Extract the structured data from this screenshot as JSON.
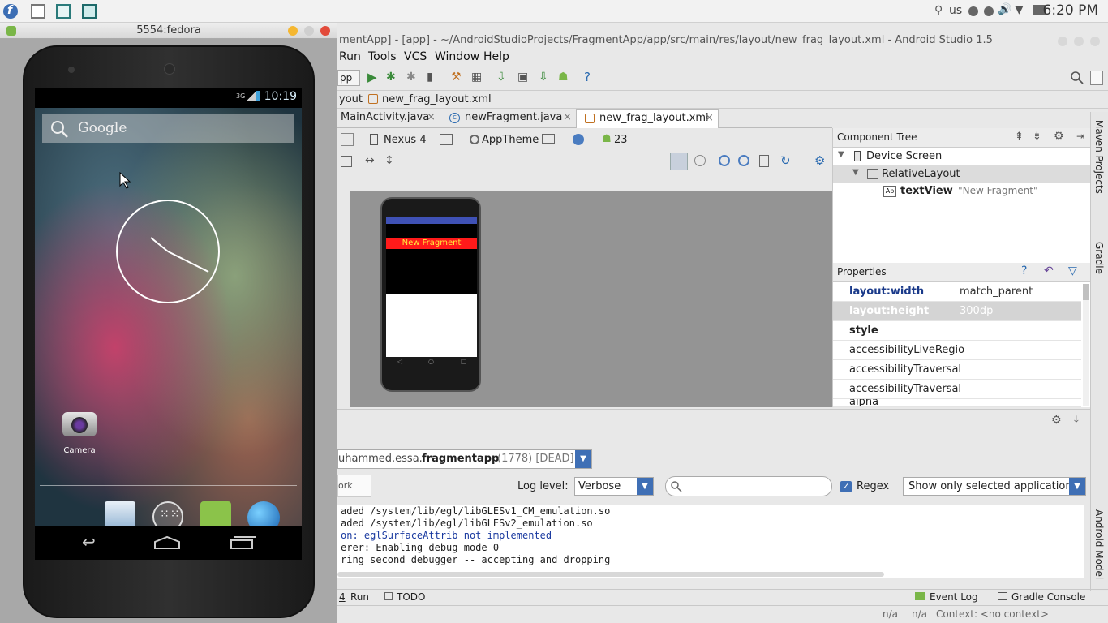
{
  "top_panel": {
    "keyboard": "us",
    "clock": "6:20 PM"
  },
  "emulator": {
    "window_title": "5554:fedora",
    "status_time": "10:19",
    "status_network": "3G",
    "search_label": "Google",
    "camera_label": "Camera"
  },
  "studio": {
    "window_title": "mentApp] - [app] - ~/AndroidStudioProjects/FragmentApp/app/src/main/res/layout/new_frag_layout.xml - Android Studio 1.5",
    "menu": [
      "Run",
      "Tools",
      "VCS",
      "Window",
      "Help"
    ],
    "toolbar_dropdown": "pp",
    "breadcrumb": [
      "yout",
      "new_frag_layout.xml"
    ],
    "tabs": [
      {
        "label": "MainActivity.java"
      },
      {
        "label": "newFragment.java"
      },
      {
        "label": "new_frag_layout.xml"
      }
    ],
    "designer": {
      "device": "Nexus 4",
      "theme": "AppTheme",
      "api": "23",
      "preview_text": "New Fragment"
    },
    "component_tree": {
      "title": "Component Tree",
      "nodes": [
        {
          "label": "Device Screen"
        },
        {
          "label": "RelativeLayout"
        },
        {
          "label": "textView",
          "detail": "- \"New Fragment\""
        }
      ]
    },
    "properties": {
      "title": "Properties",
      "rows": [
        {
          "name": "layout:width",
          "value": "match_parent"
        },
        {
          "name": "layout:height",
          "value": "300dp"
        },
        {
          "name": "style",
          "value": ""
        },
        {
          "name": "accessibilityLiveRegio",
          "value": ""
        },
        {
          "name": "accessibilityTraversal",
          "value": ""
        },
        {
          "name": "accessibilityTraversal",
          "value": ""
        },
        {
          "name": "alpha",
          "value": ""
        }
      ]
    },
    "right_strip": [
      "Maven Projects",
      "Gradle",
      "Android Model"
    ],
    "logcat": {
      "process_prefix": "uhammed.essa.",
      "process_bold": "fragmentapp",
      "process_suffix": "(1778) [DEAD]",
      "filter_left": "ork",
      "log_level_label": "Log level:",
      "log_level": "Verbose",
      "regex_label": "Regex",
      "filter_mode": "Show only selected application",
      "lines": [
        "aded /system/lib/egl/libGLESv1_CM_emulation.so",
        "aded /system/lib/egl/libGLESv2_emulation.so",
        "on: eglSurfaceAttrib not implemented",
        "erer: Enabling debug mode 0",
        "ring second debugger -- accepting and dropping"
      ]
    },
    "bottom_tools": {
      "run_num": "4",
      "run": "Run",
      "todo": "TODO",
      "event_log": "Event Log",
      "gradle_console": "Gradle Console"
    },
    "status": {
      "na1": "n/a",
      "na2": "n/a",
      "context": "Context: <no context>"
    }
  }
}
